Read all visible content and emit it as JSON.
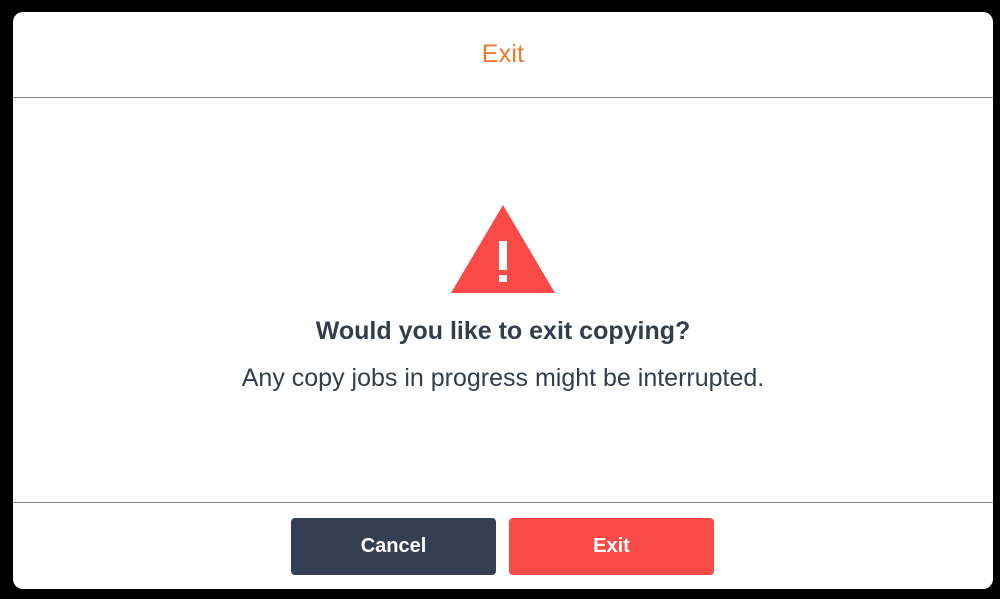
{
  "dialog": {
    "title": "Exit",
    "icon": "warning-icon",
    "message_title": "Would you like to exit copying?",
    "message_text": "Any copy jobs in progress might be interrupted.",
    "cancel_label": "Cancel",
    "exit_label": "Exit"
  },
  "colors": {
    "title": "#f07a2a",
    "warning": "#fa4a48",
    "cancel_button": "#353f52",
    "exit_button": "#fa4a48",
    "text": "#353d4d"
  }
}
